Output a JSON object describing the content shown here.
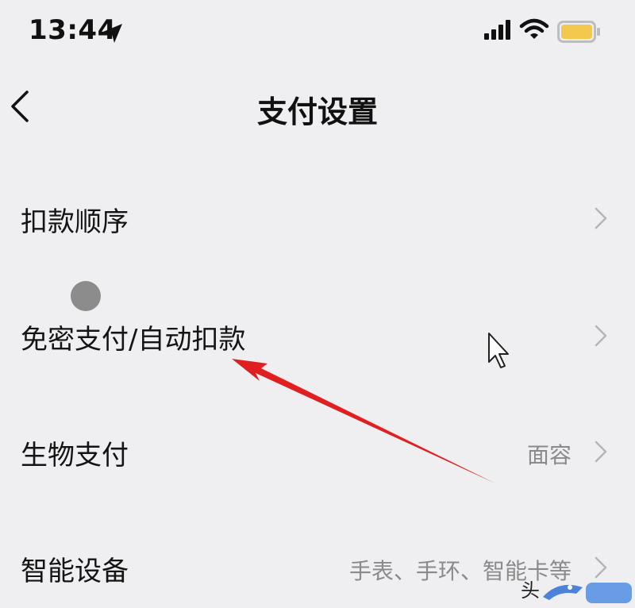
{
  "status_bar": {
    "time": "13:44",
    "icons": [
      "location-arrow-icon",
      "signal-icon",
      "wifi-icon",
      "battery-icon"
    ],
    "battery_color": "#f2c94c"
  },
  "nav": {
    "back_icon": "chevron-left-icon",
    "title": "支付设置"
  },
  "settings": [
    {
      "label": "扣款顺序",
      "value": ""
    },
    {
      "label": "免密支付/自动扣款",
      "value": ""
    },
    {
      "label": "生物支付",
      "value": "面容"
    },
    {
      "label": "智能设备",
      "value": "手表、手环、智能卡等"
    }
  ],
  "annotation": {
    "arrow_color": "#e02020",
    "touch_indicator_color": "#8c8c8c"
  },
  "watermark": {
    "text": "头"
  },
  "colors": {
    "background": "#efeff1",
    "chevron": "#b5b5b5"
  }
}
